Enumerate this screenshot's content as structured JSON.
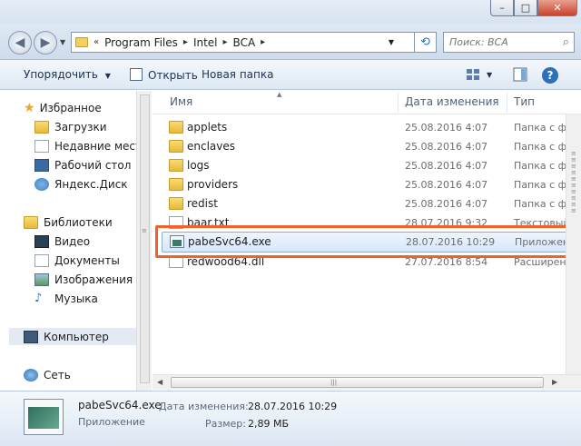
{
  "window": {
    "minimize_label": "–",
    "maximize_label": "□",
    "close_label": "✕"
  },
  "addressbar": {
    "back_icon": "back-arrow-icon",
    "forward_icon": "forward-arrow-icon",
    "overflow": "«",
    "crumbs": [
      "Program Files",
      "Intel",
      "BCA"
    ],
    "search_placeholder": "Поиск: BCA"
  },
  "toolbar": {
    "organize_label": "Упорядочить",
    "open_label": "Открыть",
    "new_folder_label": "Новая папка"
  },
  "nav": {
    "favorites": {
      "label": "Избранное",
      "items": [
        "Загрузки",
        "Недавние места",
        "Рабочий стол",
        "Яндекс.Диск"
      ]
    },
    "libraries": {
      "label": "Библиотеки",
      "items": [
        "Видео",
        "Документы",
        "Изображения",
        "Музыка"
      ]
    },
    "computer_label": "Компьютер",
    "network_label": "Сеть"
  },
  "columns": {
    "name": "Имя",
    "date": "Дата изменения",
    "type": "Тип"
  },
  "files": [
    {
      "name": "applets",
      "date": "25.08.2016 4:07",
      "type": "Папка с фай",
      "kind": "folder"
    },
    {
      "name": "enclaves",
      "date": "25.08.2016 4:07",
      "type": "Папка с фай",
      "kind": "folder"
    },
    {
      "name": "logs",
      "date": "25.08.2016 4:07",
      "type": "Папка с фай",
      "kind": "folder"
    },
    {
      "name": "providers",
      "date": "25.08.2016 4:07",
      "type": "Папка с фай",
      "kind": "folder"
    },
    {
      "name": "redist",
      "date": "25.08.2016 4:07",
      "type": "Папка с фай",
      "kind": "folder"
    },
    {
      "name": "baar.txt",
      "date": "28.07.2016 9:32",
      "type": "Текстовый д",
      "kind": "txt"
    },
    {
      "name": "pabeSvc64.exe",
      "date": "28.07.2016 10:29",
      "type": "Приложени",
      "kind": "exe",
      "selected": true
    },
    {
      "name": "redwood64.dll",
      "date": "27.07.2016 8:54",
      "type": "Расширени",
      "kind": "dll"
    }
  ],
  "details": {
    "name": "pabeSvc64.exe",
    "type": "Приложение",
    "date_label": "Дата изменения:",
    "date_value": "28.07.2016 10:29",
    "size_label": "Размер:",
    "size_value": "2,89 МБ"
  },
  "colors": {
    "highlight": "#f0622a",
    "accent": "#2e6fba"
  }
}
